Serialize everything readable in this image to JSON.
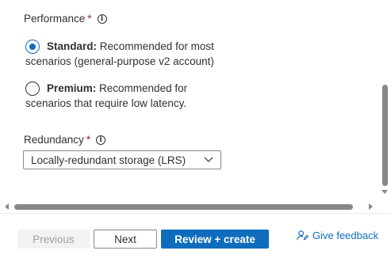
{
  "performance": {
    "label": "Performance",
    "required_mark": "*",
    "info_glyph": "i",
    "options": [
      {
        "bold": "Standard:",
        "text": " Recommended for most",
        "desc": "scenarios (general-purpose v2 account)",
        "checked": true
      },
      {
        "bold": "Premium:",
        "text": " Recommended for",
        "desc": "scenarios that require low latency.",
        "checked": false
      }
    ]
  },
  "redundancy": {
    "label": "Redundancy",
    "required_mark": "*",
    "info_glyph": "i",
    "selected": "Locally-redundant storage (LRS)"
  },
  "footer": {
    "previous_label": "Previous",
    "next_label": "Next",
    "create_label": "Review + create",
    "feedback_label": "Give feedback"
  },
  "colors": {
    "accent": "#0f6cbd",
    "required": "#a4262c",
    "disabled_bg": "#f3f2f1"
  },
  "icons": {
    "info": "info-icon",
    "dropdown": "chevron-down-icon",
    "feedback": "feedback-person-icon"
  }
}
